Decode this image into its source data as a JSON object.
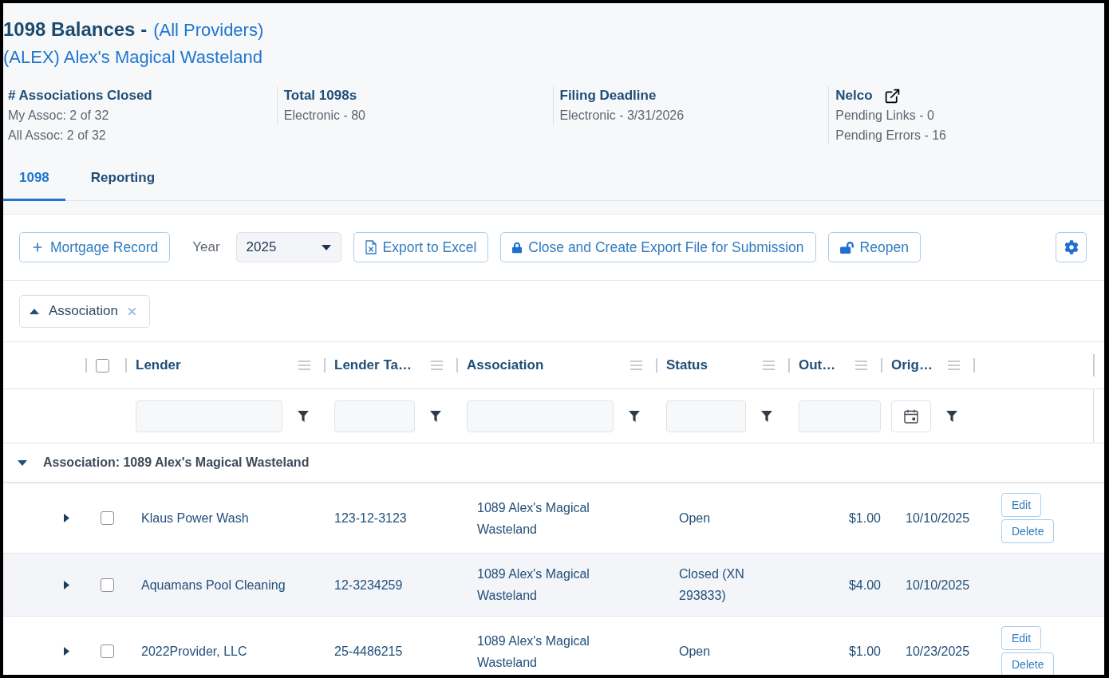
{
  "header": {
    "title": "1098 Balances -",
    "providers_link": "(All Providers)",
    "association_link": "(ALEX) Alex's Magical Wasteland"
  },
  "stats": [
    {
      "kind": "summary",
      "heading": "# Associations Closed",
      "lines": [
        "My Assoc: 2 of 32",
        "All Assoc: 2 of 32"
      ]
    },
    {
      "kind": "summary",
      "heading": "Total 1098s",
      "lines": [
        "Electronic - 80"
      ]
    },
    {
      "kind": "summary",
      "heading": "Filing Deadline",
      "lines": [
        "Electronic - 3/31/2026"
      ]
    },
    {
      "kind": "external",
      "heading": "Nelco",
      "lines": [
        "Pending Links - 0",
        "Pending Errors - 16"
      ]
    }
  ],
  "tabs": [
    {
      "label": "1098",
      "selected": true
    },
    {
      "label": "Reporting",
      "selected": false
    }
  ],
  "toolbar": {
    "add_button": "Mortgage Record",
    "year": {
      "label": "Year",
      "value": "2025"
    },
    "buttons": [
      {
        "kind": "excel",
        "label": "Export to Excel"
      },
      {
        "kind": "lock",
        "label": "Close and Create Export File for Submission"
      },
      {
        "kind": "unlock",
        "label": "Reopen"
      }
    ]
  },
  "grouping": {
    "label": "Association",
    "ascending": true
  },
  "table": {
    "select_all": {
      "checked": false
    },
    "columns": [
      {
        "label": "Lender",
        "kind": "text"
      },
      {
        "label": "Lender Ta…",
        "kind": "text"
      },
      {
        "label": "Association",
        "kind": "text"
      },
      {
        "label": "Status",
        "kind": "text"
      },
      {
        "label": "Out…",
        "kind": "number"
      },
      {
        "label": "Orig…",
        "kind": "date"
      }
    ],
    "groups": [
      {
        "label": "Association: 1089 Alex's Magical Wasteland",
        "expanded": true,
        "rows": [
          {
            "expanded": false,
            "checked": false,
            "lender": "Klaus Power Wash",
            "tax_id": "123-12-3123",
            "association": "1089 Alex's Magical Wasteland",
            "status": "Open",
            "amount": "$1.00",
            "date": "10/10/2025",
            "actions": [
              "Edit",
              "Delete"
            ]
          },
          {
            "expanded": false,
            "checked": false,
            "lender": "Aquamans Pool Cleaning",
            "tax_id": "12-3234259",
            "association": "1089 Alex's Magical Wasteland",
            "status": "Closed (XN 293833)",
            "amount": "$4.00",
            "date": "10/10/2025"
          },
          {
            "expanded": false,
            "checked": false,
            "lender": "2022Provider, LLC",
            "tax_id": "25-4486215",
            "association": "1089 Alex's Magical Wasteland",
            "status": "Open",
            "amount": "$1.00",
            "date": "10/23/2025",
            "actions": [
              "Edit",
              "Delete"
            ]
          }
        ]
      }
    ]
  }
}
